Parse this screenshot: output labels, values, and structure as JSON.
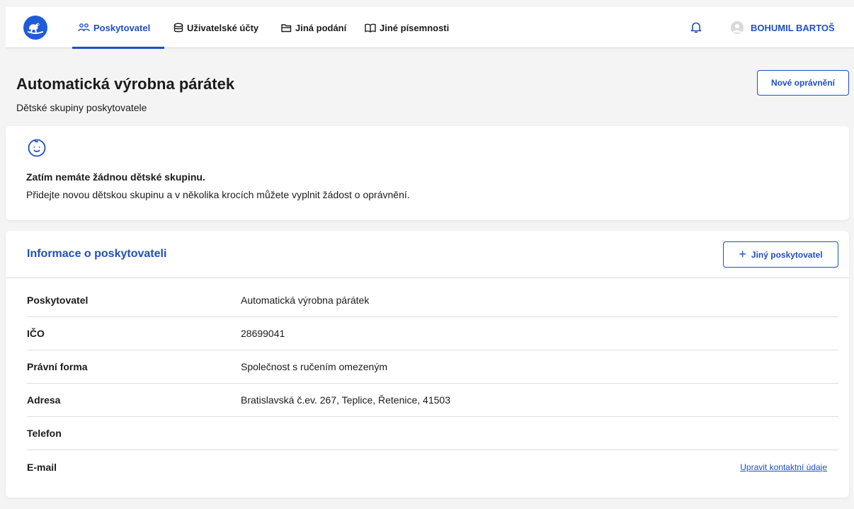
{
  "nav": {
    "items": [
      {
        "label": "Poskytovatel",
        "icon": "users-icon",
        "active": true
      },
      {
        "label": "Uživatelské účty",
        "icon": "database-icon",
        "active": false
      },
      {
        "label": "Jiná podání",
        "icon": "folder-icon",
        "active": false
      },
      {
        "label": "Jiné písemnosti",
        "icon": "book-icon",
        "active": false
      }
    ],
    "user_name": "BOHUMIL BARTOŠ",
    "accent_color": "#1f4fc1"
  },
  "page": {
    "title": "Automatická výrobna párátek",
    "subtitle": "Dětské skupiny poskytovatele",
    "new_button": "Nové oprávnění"
  },
  "empty_state": {
    "icon": "baby-face-icon",
    "title": "Zatím nemáte žádnou dětské skupinu.",
    "text": "Přidejte novou dětskou skupinu a v několika krocích můžete vyplnit žádost o oprávnění."
  },
  "provider": {
    "title": "Informace o poskytovateli",
    "other_button": "Jiný poskytovatel",
    "rows": [
      {
        "label": "Poskytovatel",
        "value": "Automatická výrobna párátek"
      },
      {
        "label": "IČO",
        "value": "28699041"
      },
      {
        "label": "Právní forma",
        "value": "Společnost s ručením omezeným"
      },
      {
        "label": "Adresa",
        "value": "Bratislavská č.ev. 267, Teplice, Řetenice, 41503"
      },
      {
        "label": "Telefon",
        "value": ""
      },
      {
        "label": "E-mail",
        "value": ""
      }
    ],
    "edit_link": "Upravit kontaktní údaje"
  }
}
